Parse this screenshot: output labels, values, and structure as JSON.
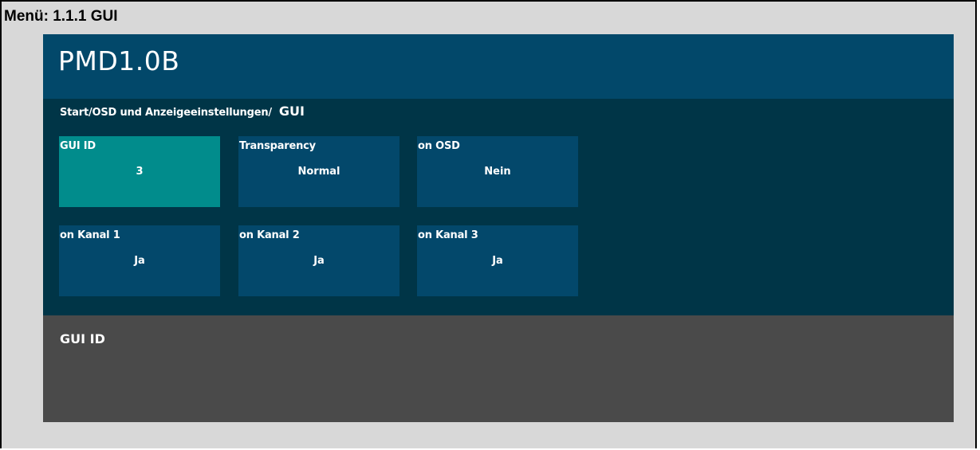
{
  "document": {
    "caption": "Menü: 1.1.1 GUI"
  },
  "app": {
    "title": "PMD1.0B"
  },
  "breadcrumb": {
    "path": "Start/OSD und Anzeigeeinstellungen/",
    "current": "GUI"
  },
  "tiles": [
    {
      "label": "GUI ID",
      "value": "3",
      "selected": true
    },
    {
      "label": "Transparency",
      "value": "Normal",
      "selected": false
    },
    {
      "label": "on OSD",
      "value": "Nein",
      "selected": false
    },
    {
      "label": "on Kanal 1",
      "value": "Ja",
      "selected": false
    },
    {
      "label": "on Kanal 2",
      "value": "Ja",
      "selected": false
    },
    {
      "label": "on Kanal 3",
      "value": "Ja",
      "selected": false
    }
  ],
  "info_panel": {
    "title": "GUI ID"
  },
  "colors": {
    "header": "#02486a",
    "body": "#003547",
    "tile": "#03486b",
    "tile_selected": "#018c8c",
    "info_panel": "#4a4a4a",
    "frame_background": "#d8d8d8"
  }
}
